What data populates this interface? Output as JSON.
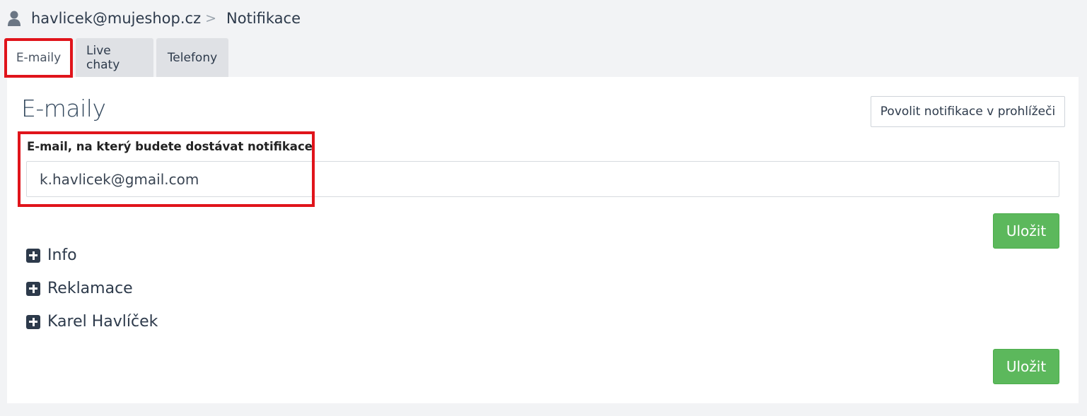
{
  "breadcrumb": {
    "user_icon": "user-icon",
    "account": "havlicek@mujeshop.cz",
    "separator": ">",
    "current": "Notifikace"
  },
  "tabs": [
    {
      "label": "E-maily",
      "active": true
    },
    {
      "label": "Live chaty",
      "active": false
    },
    {
      "label": "Telefony",
      "active": false
    }
  ],
  "panel": {
    "title": "E-maily",
    "browser_button": "Povolit notifikace v prohlížeči",
    "email_label": "E-mail, na který budete dostávat notifikace",
    "email_value": "k.havlicek@gmail.com",
    "save_label": "Uložit",
    "groups": [
      {
        "icon": "plus-square-icon",
        "label": "Info"
      },
      {
        "icon": "plus-square-icon",
        "label": "Reklamace"
      },
      {
        "icon": "plus-square-icon",
        "label": "Karel Havlíček"
      }
    ]
  },
  "colors": {
    "highlight": "#e0141b",
    "save_button": "#5cb85c",
    "background": "#f2f3f5"
  }
}
